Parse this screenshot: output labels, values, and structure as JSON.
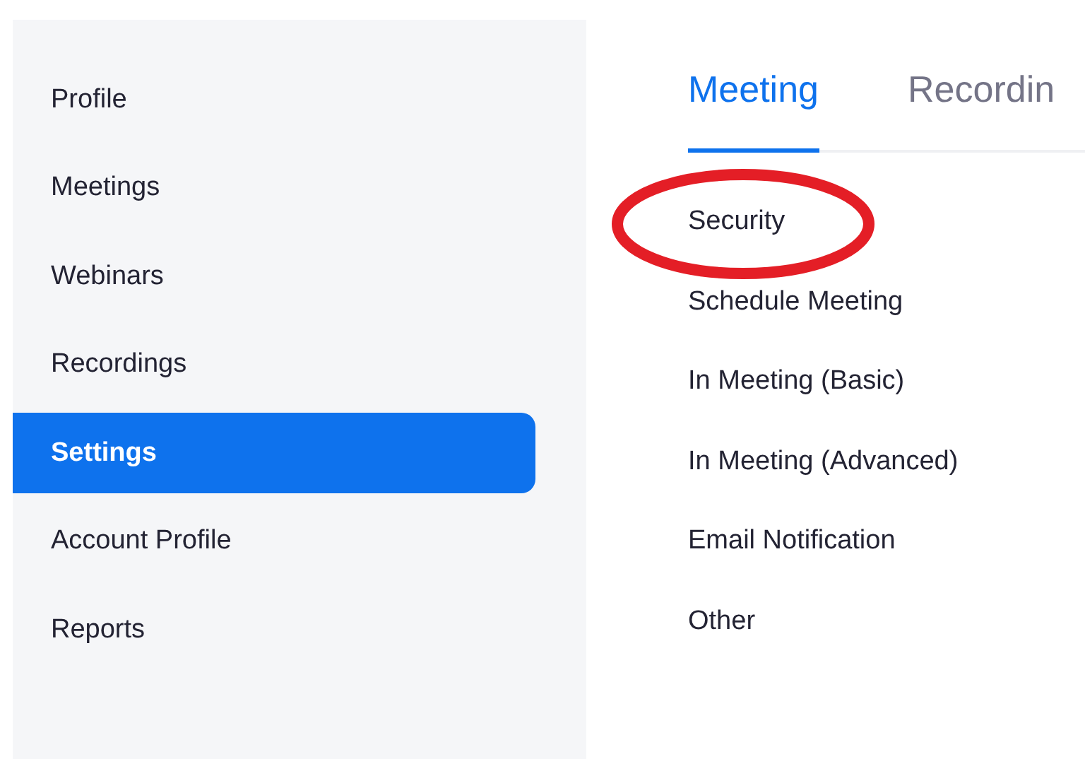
{
  "sidebar": {
    "items": [
      {
        "label": "Profile",
        "selected": false
      },
      {
        "label": "Meetings",
        "selected": false
      },
      {
        "label": "Webinars",
        "selected": false
      },
      {
        "label": "Recordings",
        "selected": false
      },
      {
        "label": "Settings",
        "selected": true
      },
      {
        "label": "Account Profile",
        "selected": false
      },
      {
        "label": "Reports",
        "selected": false
      }
    ]
  },
  "tabs": [
    {
      "label": "Meeting",
      "selected": true
    },
    {
      "label": "Recordin",
      "selected": false
    }
  ],
  "sections": [
    {
      "label": "Security",
      "highlighted": true
    },
    {
      "label": "Schedule Meeting",
      "highlighted": false
    },
    {
      "label": "In Meeting (Basic)",
      "highlighted": false
    },
    {
      "label": "In Meeting (Advanced)",
      "highlighted": false
    },
    {
      "label": "Email Notification",
      "highlighted": false
    },
    {
      "label": "Other",
      "highlighted": false
    }
  ]
}
